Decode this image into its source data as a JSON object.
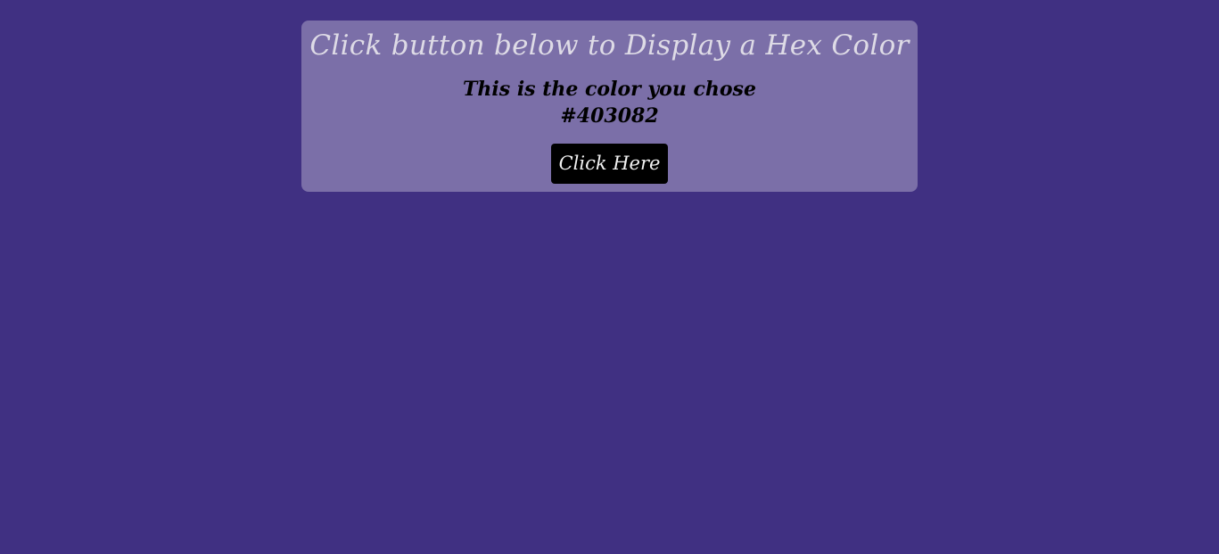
{
  "page": {
    "background_color": "#403082"
  },
  "card": {
    "title": "Click button below to Display a Hex Color",
    "subtitle": "This is the color you chose",
    "hex_value": "#403082",
    "button_label": "Click Here",
    "card_color": "#7b6fa8"
  }
}
